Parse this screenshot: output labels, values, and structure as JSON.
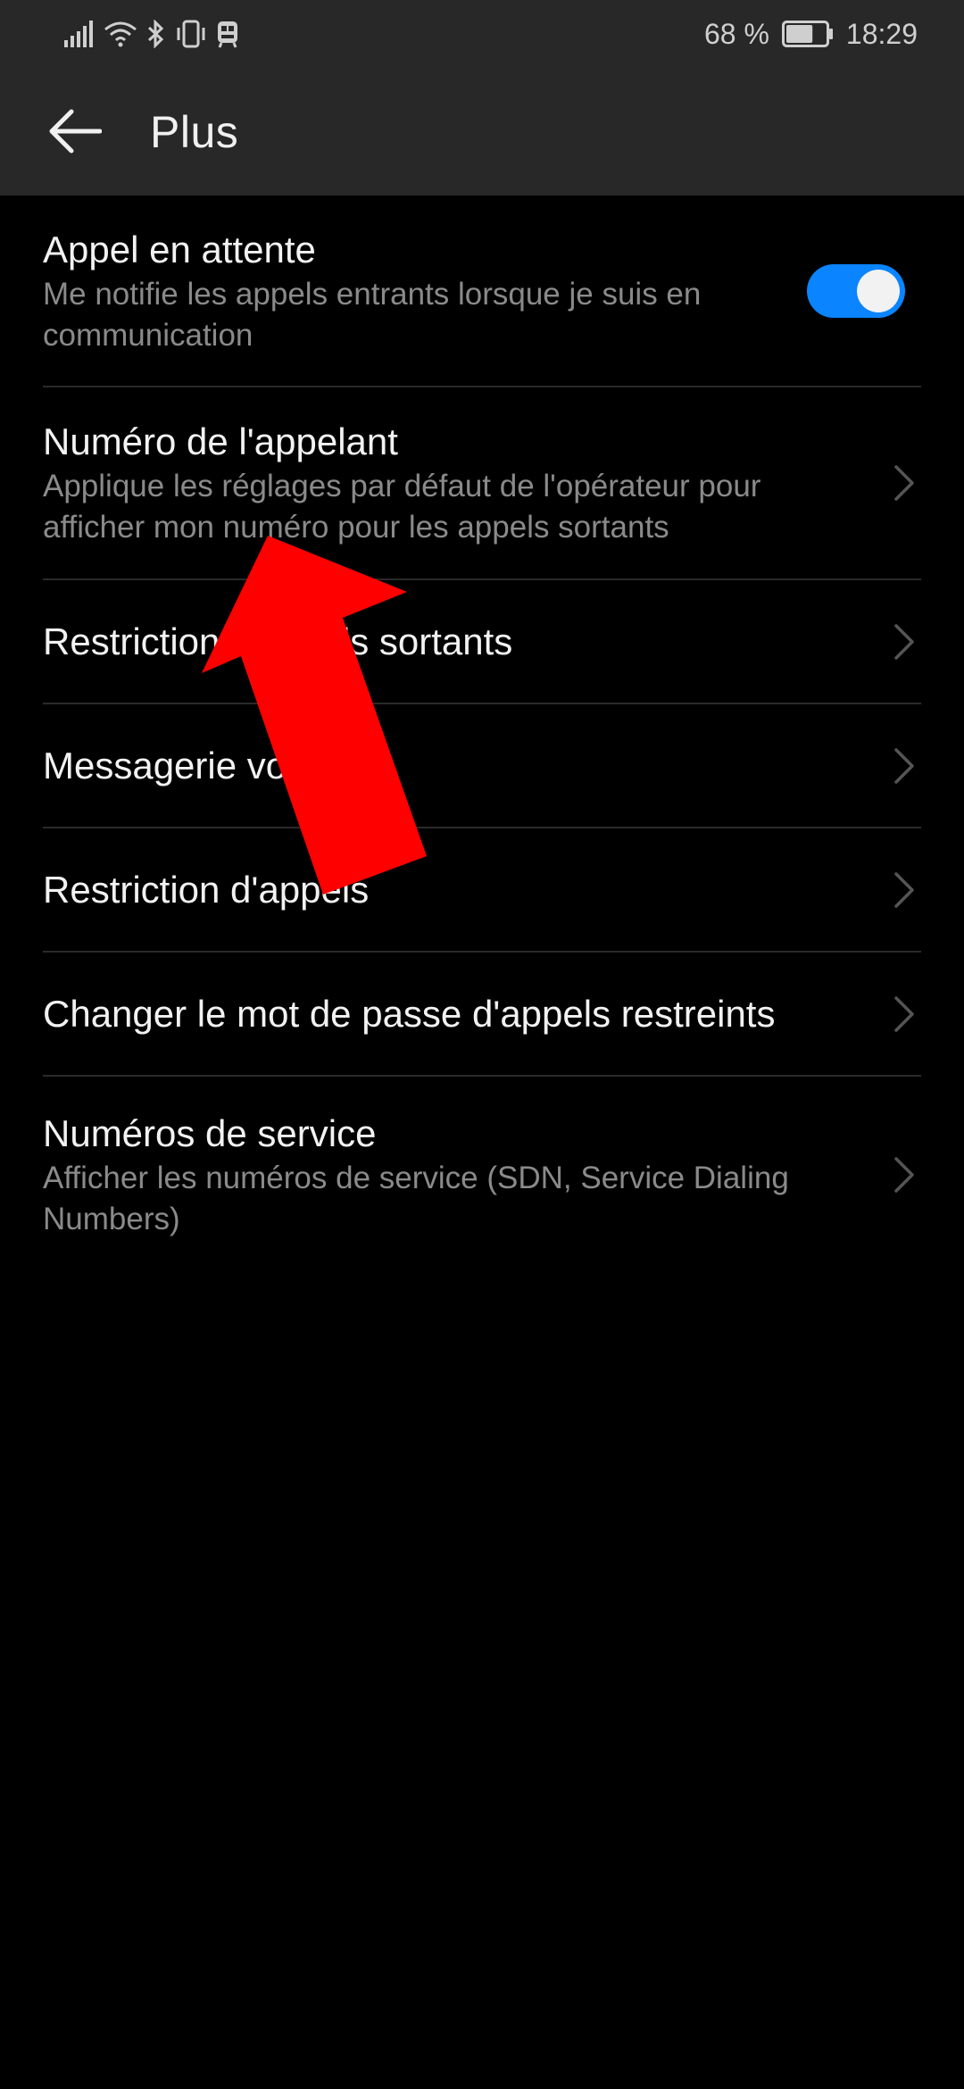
{
  "status_bar": {
    "battery_percent": "68 %",
    "battery_level": 0.68,
    "time": "18:29",
    "icons": [
      "signal-icon",
      "wifi-icon",
      "bluetooth-icon",
      "vibrate-icon",
      "sim-icon"
    ]
  },
  "app_bar": {
    "title": "Plus",
    "back_icon": "arrow-left-icon"
  },
  "settings": {
    "items": [
      {
        "title": "Appel en attente",
        "subtitle": "Me notifie les appels entrants lorsque je suis en communication",
        "control": "toggle",
        "toggle_on": true
      },
      {
        "title": "Numéro de l'appelant",
        "subtitle": "Applique les réglages par défaut de l'opérateur pour afficher mon numéro pour les appels sortants",
        "control": "chevron"
      },
      {
        "title": "Restriction d'appels sortants",
        "control": "chevron"
      },
      {
        "title": "Messagerie vocale",
        "control": "chevron"
      },
      {
        "title": "Restriction d'appels",
        "control": "chevron"
      },
      {
        "title": "Changer le mot de passe d'appels restreints",
        "control": "chevron"
      },
      {
        "title": "Numéros de service",
        "subtitle": "Afficher les numéros de service (SDN, Service Dialing Numbers)",
        "control": "chevron"
      }
    ]
  },
  "colors": {
    "background": "#000000",
    "bar": "#282828",
    "accent": "#0a84ff",
    "annotation_arrow": "#ff0000"
  }
}
